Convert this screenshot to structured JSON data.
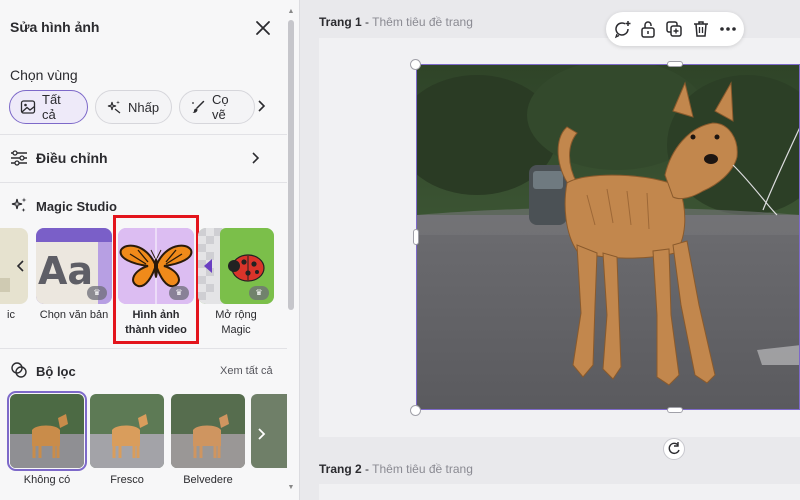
{
  "panel": {
    "title": "Sửa hình ảnh",
    "region_heading": "Chọn vùng",
    "chips": [
      {
        "label": "Tất cả",
        "icon": "image-icon",
        "active": true
      },
      {
        "label": "Nhấp",
        "icon": "sparkle-cursor-icon",
        "active": false
      },
      {
        "label": "Cọ vẽ",
        "icon": "brush-icon",
        "active": false
      }
    ],
    "adjust_label": "Điều chỉnh",
    "magic_studio_label": "Magic Studio",
    "tools": [
      {
        "label": "Chọn văn bản",
        "icon": "text-aa-icon",
        "pro": true
      },
      {
        "label": "Hình ảnh thành video",
        "icon": "butterfly-icon",
        "pro": true,
        "highlighted": true
      },
      {
        "label": "Mở rộng Magic",
        "icon": "ladybug-icon",
        "pro": true
      }
    ],
    "partial_tool_label": "ic",
    "filters_label": "Bộ lọc",
    "see_all": "Xem tất cả",
    "filters": [
      {
        "name": "Không có",
        "selected": true
      },
      {
        "name": "Fresco",
        "selected": false
      },
      {
        "name": "Belvedere",
        "selected": false
      }
    ]
  },
  "canvas": {
    "page1": {
      "number": "Trang 1",
      "separator": " - ",
      "placeholder": "Thêm tiêu đề trang"
    },
    "page2": {
      "number": "Trang 2",
      "separator": " - ",
      "placeholder": "Thêm tiêu đề trang"
    },
    "toolbar": [
      "comment-add-icon",
      "lock-open-icon",
      "duplicate-icon",
      "trash-icon",
      "more-icon"
    ]
  },
  "colors": {
    "accent": "#7d69c9",
    "highlight": "#e3141c",
    "panel_bg": "#f7f7f8",
    "canvas_bg": "#e9e9ec"
  }
}
